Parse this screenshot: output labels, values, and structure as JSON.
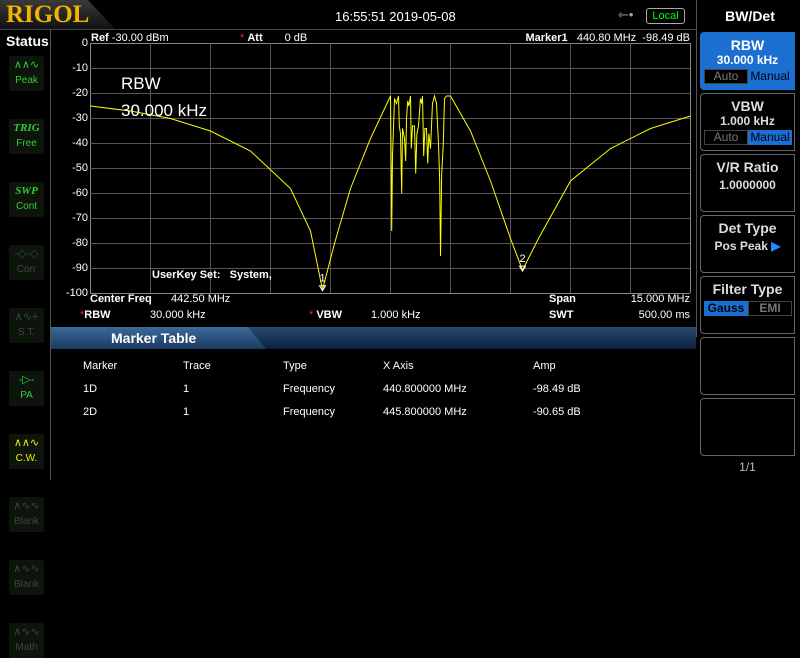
{
  "header": {
    "brand": "RIGOL",
    "datetime": "16:55:51 2019-05-08",
    "usb_icon": "usb-icon",
    "remote": "Local"
  },
  "status": {
    "title": "Status",
    "items": [
      {
        "icon": "peak-icon",
        "label": "Peak",
        "color": "#3c3",
        "active": true
      },
      {
        "icon": "TRIG",
        "label": "Free",
        "color": "#3c3",
        "active": true
      },
      {
        "icon": "SWP",
        "label": "Cont",
        "color": "#3c3",
        "active": true
      },
      {
        "icon": "corr-icon",
        "label": "Corr",
        "color": "#3a4a3a",
        "active": false
      },
      {
        "icon": "st-icon",
        "label": "S.T.",
        "color": "#3a4a3a",
        "active": false
      },
      {
        "icon": "pa-icon",
        "label": "PA",
        "color": "#3c3",
        "active": true
      },
      {
        "icon": "cw-icon",
        "label": "C.W.",
        "color": "#ee0",
        "active": true
      },
      {
        "icon": "blank-icon",
        "label": "Blank",
        "color": "#3a4a3a",
        "active": false
      },
      {
        "icon": "blank-icon",
        "label": "Blank",
        "color": "#3a4a3a",
        "active": false
      },
      {
        "icon": "math-icon",
        "label": "Math",
        "color": "#3a4a3a",
        "active": false
      }
    ]
  },
  "plot": {
    "ref_label": "Ref",
    "ref_value": "-30.00 dBm",
    "att_label": "Att",
    "att_value": "0 dB",
    "marker_label": "Marker1",
    "marker_freq": "440.80 MHz",
    "marker_amp": "-98.49 dB",
    "y_ticks": [
      "0",
      "-10",
      "-20",
      "-30",
      "-40",
      "-50",
      "-60",
      "-70",
      "-80",
      "-90",
      "-100"
    ],
    "overlay_line1": "RBW",
    "overlay_line2": "30.000 kHz",
    "userkey": "UserKey Set:   System,",
    "x_range_mhz": [
      435,
      450
    ],
    "y_range_db": [
      -100,
      0
    ],
    "trace_color": "#ffff00",
    "grid": true,
    "markers": [
      {
        "label": "1",
        "freq_mhz": 440.8,
        "amp_db": -98.49
      },
      {
        "label": "2",
        "freq_mhz": 445.8,
        "amp_db": -90.65
      }
    ],
    "trace": [
      [
        435,
        -25
      ],
      [
        436,
        -27
      ],
      [
        437,
        -30
      ],
      [
        438,
        -35
      ],
      [
        439,
        -43
      ],
      [
        440,
        -58
      ],
      [
        440.5,
        -75
      ],
      [
        440.8,
        -98.5
      ],
      [
        441.1,
        -80
      ],
      [
        441.5,
        -58
      ],
      [
        442,
        -38
      ],
      [
        442.5,
        -21
      ],
      [
        442.52,
        -55
      ],
      [
        442.53,
        -75
      ],
      [
        442.55,
        -45
      ],
      [
        442.6,
        -22
      ],
      [
        442.65,
        -24
      ],
      [
        442.7,
        -21
      ],
      [
        442.72,
        -33
      ],
      [
        442.75,
        -36
      ],
      [
        442.78,
        -60
      ],
      [
        442.8,
        -34
      ],
      [
        442.85,
        -38
      ],
      [
        442.88,
        -47
      ],
      [
        442.9,
        -30
      ],
      [
        442.93,
        -23
      ],
      [
        442.96,
        -25
      ],
      [
        443.0,
        -21
      ],
      [
        443.02,
        -42
      ],
      [
        443.05,
        -33
      ],
      [
        443.1,
        -33
      ],
      [
        443.13,
        -52
      ],
      [
        443.16,
        -36
      ],
      [
        443.2,
        -33
      ],
      [
        443.25,
        -22
      ],
      [
        443.28,
        -24
      ],
      [
        443.3,
        -21
      ],
      [
        443.33,
        -45
      ],
      [
        443.36,
        -34
      ],
      [
        443.4,
        -34
      ],
      [
        443.43,
        -48
      ],
      [
        443.46,
        -36
      ],
      [
        443.5,
        -42
      ],
      [
        443.55,
        -24
      ],
      [
        443.6,
        -21
      ],
      [
        443.65,
        -24
      ],
      [
        443.7,
        -40
      ],
      [
        443.73,
        -55
      ],
      [
        443.75,
        -85
      ],
      [
        443.78,
        -52
      ],
      [
        443.82,
        -40
      ],
      [
        443.85,
        -22
      ],
      [
        443.9,
        -21
      ],
      [
        444,
        -21
      ],
      [
        444.5,
        -35
      ],
      [
        445,
        -55
      ],
      [
        445.5,
        -78
      ],
      [
        445.8,
        -90.65
      ],
      [
        446.2,
        -78
      ],
      [
        447,
        -55
      ],
      [
        448,
        -42
      ],
      [
        449,
        -34
      ],
      [
        450,
        -29
      ]
    ]
  },
  "info": {
    "center_label": "Center Freq",
    "center_value": "442.50 MHz",
    "span_label": "Span",
    "span_value": "15.000 MHz",
    "rbw_label": "RBW",
    "rbw_value": "30.000 kHz",
    "vbw_label": "VBW",
    "vbw_value": "1.000 kHz",
    "swt_label": "SWT",
    "swt_value": "500.00 ms"
  },
  "marker_table": {
    "title": "Marker Table",
    "columns": [
      "Marker",
      "Trace",
      "Type",
      "X Axis",
      "Amp"
    ],
    "rows": [
      [
        "1D",
        "1",
        "Frequency",
        "440.800000 MHz",
        "-98.49 dB"
      ],
      [
        "2D",
        "1",
        "Frequency",
        "445.800000 MHz",
        "-90.65 dB"
      ]
    ]
  },
  "menu": {
    "title": "BW/Det",
    "rbw": {
      "label": "RBW",
      "value": "30.000 kHz",
      "auto": "Auto",
      "manual": "Manual"
    },
    "vbw": {
      "label": "VBW",
      "value": "1.000 kHz",
      "auto": "Auto",
      "manual": "Manual"
    },
    "vr": {
      "label": "V/R Ratio",
      "value": "1.0000000"
    },
    "det": {
      "label": "Det Type",
      "value": "Pos Peak"
    },
    "filter": {
      "label": "Filter Type",
      "gauss": "Gauss",
      "emi": "EMI"
    },
    "page": "1/1"
  }
}
